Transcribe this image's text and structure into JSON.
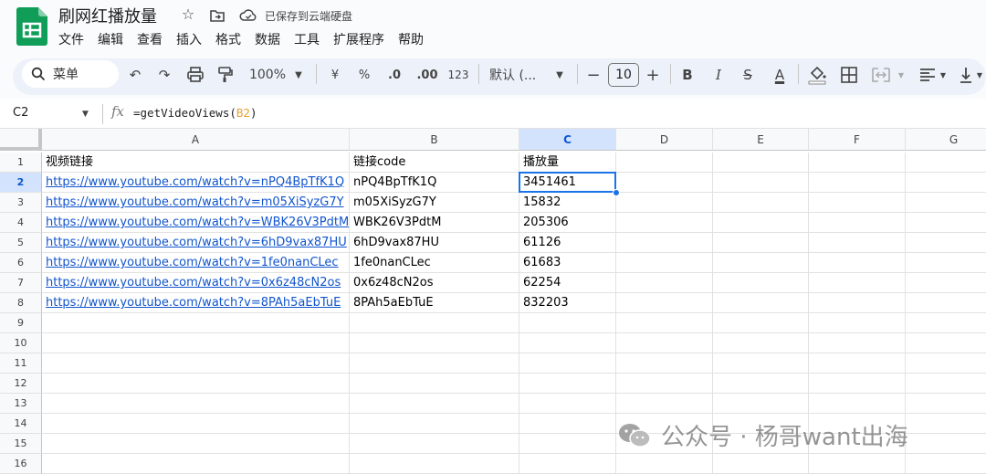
{
  "app": {
    "title": "刷网红播放量",
    "saved_status": "已保存到云端硬盘",
    "icons": {
      "star": "star-icon",
      "move": "folder-move-icon",
      "cloud": "cloud-saved-icon"
    },
    "accent": "#1a73e8",
    "link_color": "#1155cc",
    "sheets_green": "#0f9d58"
  },
  "menu": [
    "文件",
    "编辑",
    "查看",
    "插入",
    "格式",
    "数据",
    "工具",
    "扩展程序",
    "帮助"
  ],
  "toolbar": {
    "search_label": "菜单",
    "zoom": "100%",
    "currency": "¥",
    "percent": "%",
    "dec_decrease": ".0",
    "dec_increase": ".00",
    "number_format": "123",
    "font": "默认 (...",
    "font_size": "10",
    "bold": "B",
    "italic": "I",
    "strike": "S",
    "text_color": "A"
  },
  "formula_bar": {
    "cell_ref": "C2",
    "fx": "fx",
    "formula_prefix": "=getVideoViews(",
    "formula_ref": "B2",
    "formula_suffix": ")"
  },
  "columns": [
    "A",
    "B",
    "C",
    "D",
    "E",
    "F",
    "G"
  ],
  "rows": [
    "1",
    "2",
    "3",
    "4",
    "5",
    "6",
    "7",
    "8",
    "9",
    "10",
    "11",
    "12",
    "13",
    "14",
    "15",
    "16"
  ],
  "headers": {
    "a": "视频链接",
    "b": "链接code",
    "c": "播放量"
  },
  "data": [
    {
      "url": "https://www.youtube.com/watch?v=nPQ4BpTfK1Q",
      "code": "nPQ4BpTfK1Q",
      "views": "3451461"
    },
    {
      "url": "https://www.youtube.com/watch?v=m05XiSyzG7Y",
      "code": "m05XiSyzG7Y",
      "views": "15832"
    },
    {
      "url": "https://www.youtube.com/watch?v=WBK26V3PdtM",
      "code": "WBK26V3PdtM",
      "views": "205306"
    },
    {
      "url": "https://www.youtube.com/watch?v=6hD9vax87HU",
      "code": "6hD9vax87HU",
      "views": "61126"
    },
    {
      "url": "https://www.youtube.com/watch?v=1fe0nanCLec",
      "code": "1fe0nanCLec",
      "views": "61683"
    },
    {
      "url": "https://www.youtube.com/watch?v=0x6z48cN2os",
      "code": "0x6z48cN2os",
      "views": "62254"
    },
    {
      "url": "https://www.youtube.com/watch?v=8PAh5aEbTuE",
      "code": "8PAh5aEbTuE",
      "views": "832203"
    }
  ],
  "watermark": "公众号 · 杨哥want出海"
}
